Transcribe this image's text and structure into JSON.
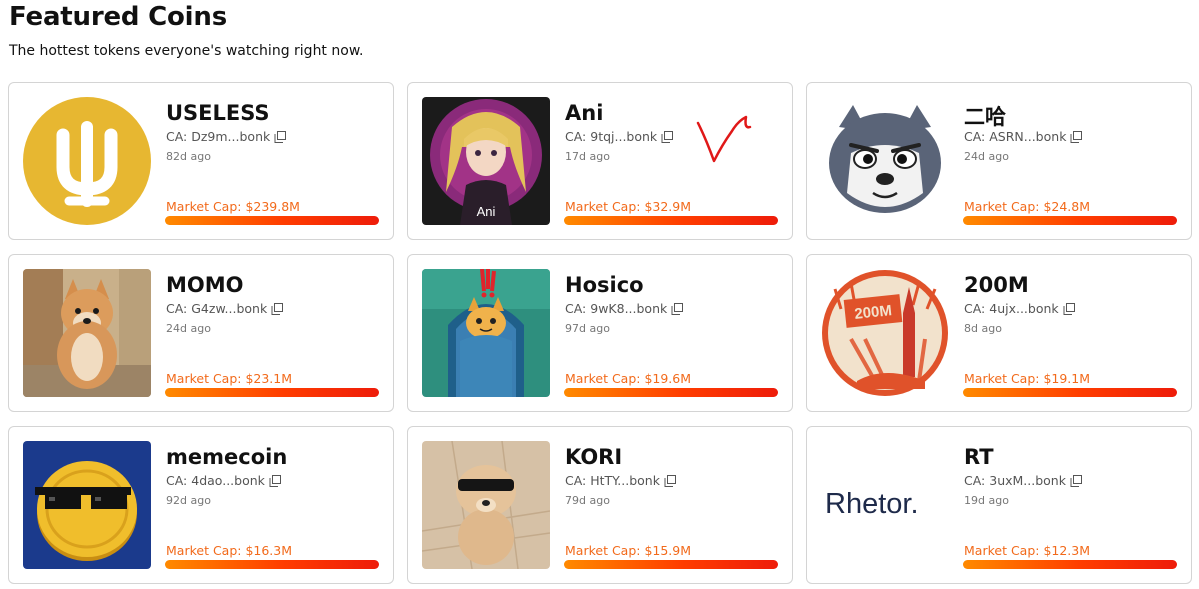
{
  "header": {
    "title": "Featured Coins",
    "subtitle": "The hottest tokens everyone's watching right now."
  },
  "coins": [
    {
      "name": "USELESS",
      "ca": "CA: Dz9m...bonk",
      "age": "82d ago",
      "market_cap": "Market Cap: $239.8M",
      "image": "useless-logo",
      "accent": "#e7b731"
    },
    {
      "name": "Ani",
      "ca": "CA: 9tqj...bonk",
      "age": "17d ago",
      "market_cap": "Market Cap: $32.9M",
      "image": "ani-anime-girl",
      "image_caption": "Ani",
      "accent": "#7a1d63"
    },
    {
      "name": "二哈",
      "ca": "CA: ASRN...bonk",
      "age": "24d ago",
      "market_cap": "Market Cap: $24.8M",
      "image": "husky-face",
      "accent": "#5a6478"
    },
    {
      "name": "MOMO",
      "ca": "CA: G4zw...bonk",
      "age": "24d ago",
      "market_cap": "Market Cap: $23.1M",
      "image": "shiba-dog-photo",
      "accent": "#d9a56b"
    },
    {
      "name": "Hosico",
      "ca": "CA: 9wK8...bonk",
      "age": "97d ago",
      "market_cap": "Market Cap: $19.6M",
      "image": "hosico-cat",
      "accent": "#2a9d8f"
    },
    {
      "name": "200M",
      "ca": "CA: 4ujx...bonk",
      "age": "8d ago",
      "market_cap": "Market Cap: $19.1M",
      "image": "200m-rocket-logo",
      "image_caption": "200M",
      "accent": "#e0522a"
    },
    {
      "name": "memecoin",
      "ca": "CA: 4dao...bonk",
      "age": "92d ago",
      "market_cap": "Market Cap: $16.3M",
      "image": "memecoin-sunglasses-coin",
      "accent": "#1b3a8c"
    },
    {
      "name": "KORI",
      "ca": "CA: HtTY...bonk",
      "age": "79d ago",
      "market_cap": "Market Cap: $15.9M",
      "image": "kori-dog-sunglasses",
      "accent": "#c9a27a"
    },
    {
      "name": "RT",
      "ca": "CA: 3uxM...bonk",
      "age": "19d ago",
      "market_cap": "Market Cap: $12.3M",
      "image": "rhetor-logo",
      "image_caption": "Rhetor.",
      "accent": "#1e2a4a"
    }
  ],
  "theme": {
    "market_cap_color": "#f26a1b",
    "bar_gradient": [
      "#ff8a00",
      "#ee1c0a"
    ],
    "card_border": "#d4d4d4"
  }
}
